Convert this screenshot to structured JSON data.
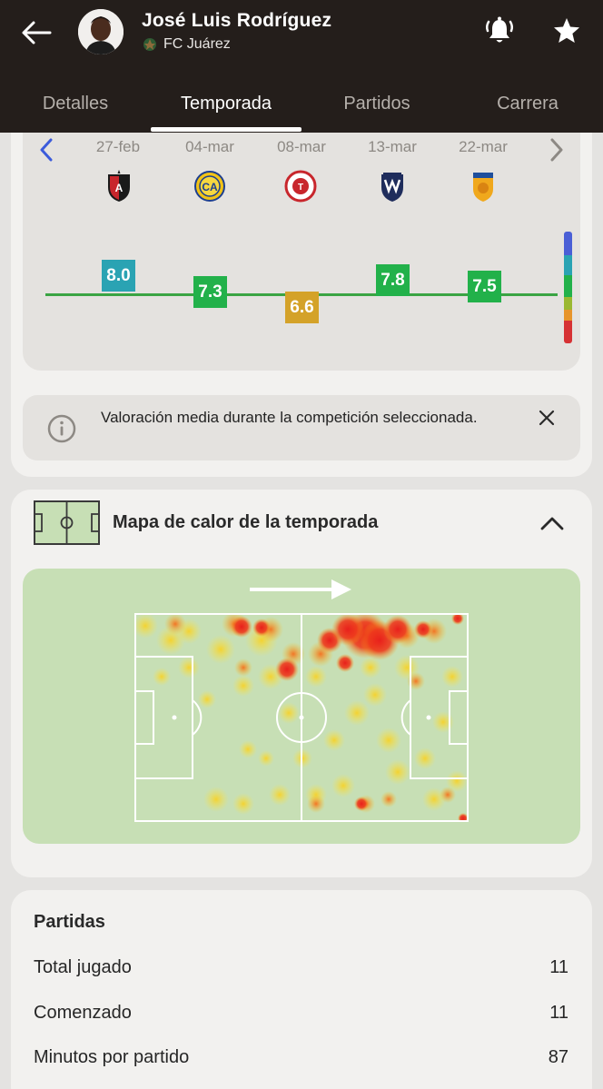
{
  "player": {
    "name": "José Luis Rodríguez",
    "team": "FC Juárez"
  },
  "tabs": [
    {
      "label": "Detalles",
      "active": false
    },
    {
      "label": "Temporada",
      "active": true
    },
    {
      "label": "Partidos",
      "active": false
    },
    {
      "label": "Carrera",
      "active": false
    }
  ],
  "matches": [
    {
      "date": "27-feb",
      "opponent_icon": "atlas-crest-icon",
      "rating": "8.0",
      "rating_color": "#2aa3b3"
    },
    {
      "date": "04-mar",
      "opponent_icon": "club-america-crest-icon",
      "rating": "7.3",
      "rating_color": "#22b14a"
    },
    {
      "date": "08-mar",
      "opponent_icon": "toluca-crest-icon",
      "rating": "6.6",
      "rating_color": "#d4a229"
    },
    {
      "date": "13-mar",
      "opponent_icon": "monterrey-crest-icon",
      "rating": "7.8",
      "rating_color": "#22b14a"
    },
    {
      "date": "22-mar",
      "opponent_icon": "tigres-crest-icon",
      "rating": "7.5",
      "rating_color": "#22b14a"
    }
  ],
  "rating_scale_colors": [
    "#4a5fd6",
    "#2aa3b3",
    "#22b14a",
    "#9ab831",
    "#e7942a",
    "#d63234"
  ],
  "info": {
    "text": "Valoración media durante la competición seleccionada."
  },
  "heatmap": {
    "title": "Mapa de calor de la temporada"
  },
  "stats": {
    "heading": "Partidas",
    "rows": [
      {
        "label": "Total jugado",
        "value": "11"
      },
      {
        "label": "Comenzado",
        "value": "11"
      },
      {
        "label": "Minutos por partido",
        "value": "87"
      }
    ]
  },
  "colors": {
    "header_bg": "#241e1b",
    "accent_nav": "#3b5bdb",
    "pitch_bg": "#c7dfb5"
  }
}
